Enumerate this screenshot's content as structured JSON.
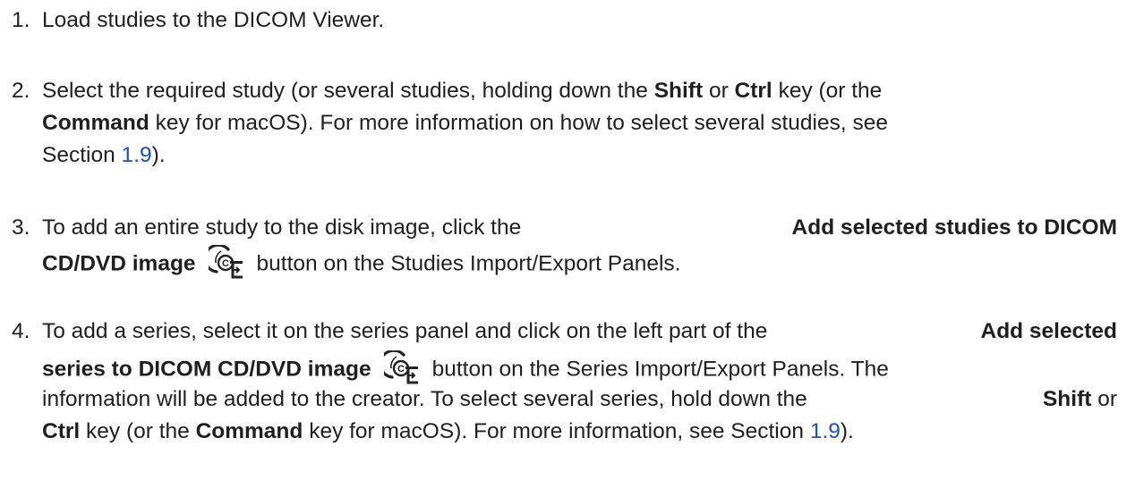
{
  "steps": [
    {
      "number": "1.",
      "text": "Load studies to the DICOM Viewer."
    },
    {
      "number": "2.",
      "l1_a": "Select the required study (or several studies, holding down the",
      "l1_b1": "Shift",
      "l1_c": "or",
      "l1_b2": "Ctrl",
      "l1_d": "key (or the",
      "l2_b": "Command",
      "l2_c": "key for macOS). For more information on how to select several studies, see",
      "l3_a": "Section",
      "l3_ref": "1.9",
      "l3_b": ")."
    },
    {
      "number": "3.",
      "l1_a": "To add an entire study to the disk image, click the",
      "l1_b": "Add selected studies to DICOM",
      "l2_b": "CD/DVD image",
      "l2_icon": "add-to-cd-icon",
      "l2_c": "button on the Studies Import/Export Panels."
    },
    {
      "number": "4.",
      "l1_a": "To add a series, select it on the series panel and click on the left part of the",
      "l1_b": "Add selected",
      "l2_b": "series to DICOM CD/DVD image",
      "l2_icon": "add-to-cd-icon",
      "l2_c": "button on the Series Import/Export Panels. The",
      "l3_a": "information will be added to the creator. To select several series, hold down the",
      "l3_b": "Shift",
      "l3_c": "or",
      "l4_b1": "Ctrl",
      "l4_a": "key (or the",
      "l4_b2": "Command",
      "l4_c": "key for macOS). For more information, see Section",
      "l4_ref": "1.9",
      "l4_d": ")."
    }
  ],
  "colors": {
    "text": "#1f1f1f",
    "link": "#1a4fc9"
  }
}
